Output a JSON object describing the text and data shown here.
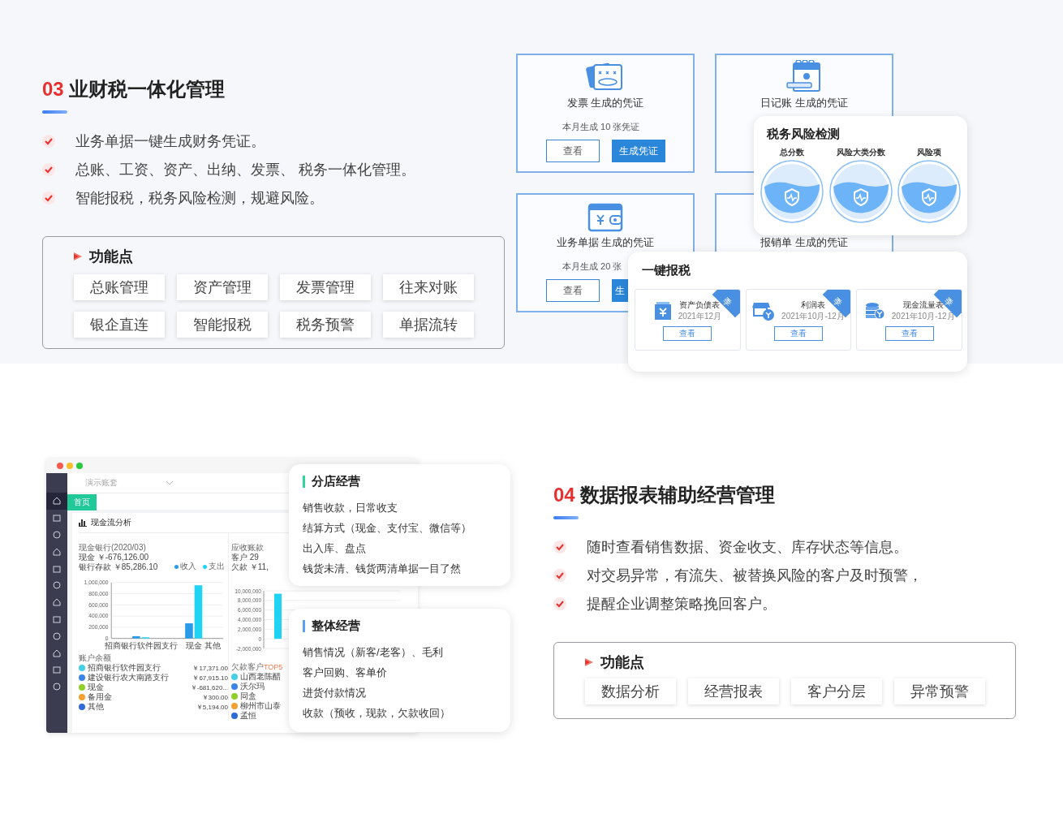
{
  "section_finance": {
    "number": "03",
    "title": "业财税一体化管理",
    "points": [
      "业务单据一键生成财务凭证。",
      "总账、工资、资产、出纳、发票、 税务一体化管理。",
      "智能报税，税务风险检测，规避风险。"
    ],
    "features": {
      "title": "功能点",
      "items": [
        "总账管理",
        "资产管理",
        "发票管理",
        "往来对账",
        "银企直连",
        "智能报税",
        "税务预警",
        "单据流转"
      ]
    }
  },
  "voucher_cards": [
    {
      "kind": "invoice",
      "title": "发票 生成的凭证",
      "stat": "本月生成 10 张凭证",
      "buttons": [
        "查看",
        "生成凭证"
      ]
    },
    {
      "kind": "journal",
      "title": "日记账 生成的凭证"
    },
    {
      "kind": "wallet",
      "title": "业务单据 生成的凭证",
      "stat": "本月生成 20 张",
      "buttons": [
        "查看",
        "生"
      ]
    },
    {
      "title": "报销单 生成的凭证"
    }
  ],
  "risk_panel": {
    "title": "税务风险检测",
    "gauges": [
      "总分数",
      "风险大类分数",
      "风险项"
    ]
  },
  "tax_panel": {
    "title": "一键报税",
    "reports": [
      {
        "kind": "balance",
        "title": "资产负债表",
        "period": "2021年12月",
        "tag": "季",
        "button": "查看"
      },
      {
        "kind": "profit",
        "title": "利润表",
        "period": "2021年10月-12月",
        "tag": "季",
        "button": "查看"
      },
      {
        "kind": "cashflow",
        "title": "现金流量表",
        "period": "2021年10月-12月",
        "tag": "季",
        "button": "查看"
      }
    ]
  },
  "dashboard": {
    "company": "演示账套",
    "tab": "首页",
    "panel_title": "现金流分析",
    "sidebar": [
      {
        "selected": true
      },
      {
        "selected": false
      },
      {
        "selected": false
      },
      {
        "selected": false
      },
      {
        "selected": false
      },
      {
        "selected": false
      },
      {
        "selected": false
      },
      {
        "selected": false
      },
      {
        "selected": false
      },
      {
        "selected": false
      },
      {
        "selected": false
      },
      {
        "selected": false
      }
    ],
    "cash_title": "现金银行(2020/03)",
    "cash_rows": [
      {
        "label": "现金",
        "amount": "￥-676,126.00"
      },
      {
        "label": "银行存款",
        "amount": "￥85,286.10"
      }
    ],
    "chart_data": {
      "type": "bar",
      "categories": [
        "招商银行软件园支行",
        "现金",
        "其他"
      ],
      "series": [
        {
          "name": "收入",
          "color": "#2a9be8",
          "values": [
            40000,
            270000,
            0
          ]
        },
        {
          "name": "支出",
          "color": "#1fd3f5",
          "values": [
            20000,
            950000,
            0
          ]
        }
      ],
      "ylim": [
        0,
        1000000
      ],
      "grid": true,
      "yticks": [
        {
          "value": 0,
          "label": "0"
        },
        {
          "value": 200000,
          "label": "200,000"
        },
        {
          "value": 400000,
          "label": "400,000"
        },
        {
          "value": 600000,
          "label": "600,000"
        },
        {
          "value": 800000,
          "label": "800,000"
        },
        {
          "value": 1000000,
          "label": "1,000,000"
        }
      ]
    },
    "balance_title": "账户余额",
    "balances": [
      {
        "name": "招商银行软件园支行",
        "amount": "￥17,371.00",
        "color": "#45d0e8"
      },
      {
        "name": "建设银行农大南路支行",
        "amount": "￥67,915.10",
        "color": "#3a86e8"
      },
      {
        "name": "现金",
        "amount": "￥-681,620...",
        "color": "#8fd12a"
      },
      {
        "name": "备用金",
        "amount": "￥300.00",
        "color": "#f5a030"
      },
      {
        "name": "其他",
        "amount": "￥5,194.00",
        "color": "#2f6ad8"
      }
    ],
    "receivable_title": "应收账款",
    "receivable_rows": [
      "客户 29",
      "欠款 ￥11,"
    ],
    "receivable_chart": {
      "chart_data": {
        "type": "bar",
        "values": [
          9400000
        ],
        "ylim": [
          -2000000,
          10000000
        ],
        "grid": true,
        "yticks": [
          {
            "value": -2000000,
            "label": "-2,000,000"
          },
          {
            "value": 0,
            "label": "0"
          },
          {
            "value": 2000000,
            "label": "2,000,000"
          },
          {
            "value": 4000000,
            "label": "4,000,000"
          },
          {
            "value": 6000000,
            "label": "6,000,000"
          },
          {
            "value": 8000000,
            "label": "8,000,000"
          },
          {
            "value": 10000000,
            "label": "10,000,000"
          }
        ]
      }
    },
    "top_title": "欠款客户",
    "top_highlight": "TOP5",
    "debtors": [
      {
        "name": "山西老陈醋",
        "color": "#45d0e8"
      },
      {
        "name": "沃尔玛",
        "color": "#3a86e8"
      },
      {
        "name": "同盒",
        "color": "#8fd12a"
      },
      {
        "name": "柳州市山泰",
        "color": "#f5a030"
      },
      {
        "name": "孟恒",
        "color": "#2f6ad8"
      }
    ]
  },
  "info_cards": [
    {
      "title": "分店经营",
      "color": "#2ed3a0",
      "lines": [
        "销售收款，日常收支",
        "结算方式（现金、支付宝、微信等）",
        "出入库、盘点",
        "钱货未清、钱货两清单据一目了然"
      ]
    },
    {
      "title": "整体经营",
      "color": "#5aa0f5",
      "lines": [
        "销售情况（新客/老客）、毛利",
        "客户回购、客单价",
        "进货付款情况",
        "收款（预收，现款，欠款收回）"
      ]
    }
  ],
  "section_data": {
    "number": "04",
    "title": "数据报表辅助经营管理",
    "points": [
      "随时查看销售数据、资金收支、库存状态等信息。",
      "对交易异常，有流失、被替换风险的客户及时预警，",
      "提醒企业调整策略挽回客户。"
    ],
    "features": {
      "title": "功能点",
      "items": [
        "数据分析",
        "经营报表",
        "客户分层",
        "异常预警"
      ]
    }
  }
}
